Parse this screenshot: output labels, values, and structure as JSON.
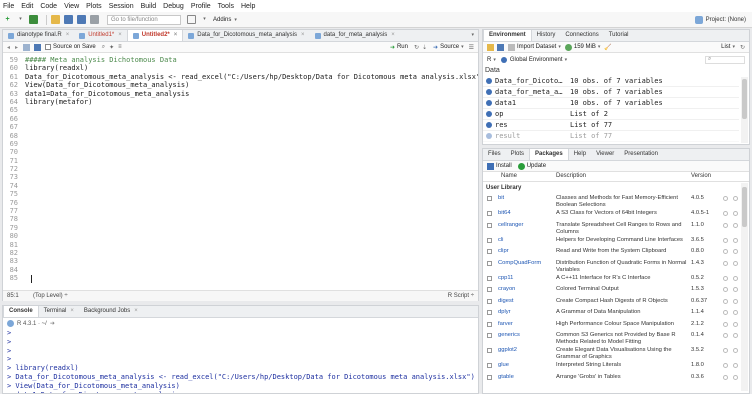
{
  "menu": [
    "File",
    "Edit",
    "Code",
    "View",
    "Plots",
    "Session",
    "Build",
    "Debug",
    "Profile",
    "Tools",
    "Help"
  ],
  "toolbar": {
    "goto_placeholder": "Go to file/function",
    "addins_label": "Addins",
    "project_label": "Project: (None)"
  },
  "editor": {
    "tabs": [
      {
        "label": "dianotype final.R",
        "active": false,
        "modified": false
      },
      {
        "label": "Untitled1*",
        "active": false,
        "modified": true
      },
      {
        "label": "Untitled2*",
        "active": true,
        "modified": true
      },
      {
        "label": "Data_for_Dicotomous_meta_analysis",
        "active": false,
        "modified": false
      },
      {
        "label": "data_for_meta_analysis",
        "active": false,
        "modified": false
      }
    ],
    "source_on_save": "Source on Save",
    "run_label": "Run",
    "source_label": "Source",
    "lines": [
      {
        "num": "59",
        "text": "##### Meta analysis Dichotomous Data",
        "kind": "comment"
      },
      {
        "num": "60",
        "text": "library(readxl)",
        "kind": "code"
      },
      {
        "num": "61",
        "text": "Data_for_Dicotomous_meta_analysis <- read_excel(\"C:/Users/hp/Desktop/Data for Dicotomous meta analysis.xlsx\")",
        "kind": "code"
      },
      {
        "num": "62",
        "text": "View(Data_for_Dicotomous_meta_analysis)",
        "kind": "code"
      },
      {
        "num": "63",
        "text": "data1=Data_for_Dicotomous_meta_analysis",
        "kind": "code"
      },
      {
        "num": "64",
        "text": "library(metafor)",
        "kind": "code"
      },
      {
        "num": "65",
        "text": "",
        "kind": "code"
      },
      {
        "num": "66",
        "text": "",
        "kind": "code"
      },
      {
        "num": "67",
        "text": "",
        "kind": "code"
      },
      {
        "num": "68",
        "text": "",
        "kind": "code"
      },
      {
        "num": "69",
        "text": "",
        "kind": "code"
      },
      {
        "num": "70",
        "text": "",
        "kind": "code"
      },
      {
        "num": "71",
        "text": "",
        "kind": "code"
      },
      {
        "num": "72",
        "text": "",
        "kind": "code"
      },
      {
        "num": "73",
        "text": "",
        "kind": "code"
      },
      {
        "num": "74",
        "text": "",
        "kind": "code"
      },
      {
        "num": "75",
        "text": "",
        "kind": "code"
      },
      {
        "num": "76",
        "text": "",
        "kind": "code"
      },
      {
        "num": "77",
        "text": "",
        "kind": "code"
      },
      {
        "num": "78",
        "text": "",
        "kind": "code"
      },
      {
        "num": "79",
        "text": "",
        "kind": "code"
      },
      {
        "num": "80",
        "text": "",
        "kind": "code"
      },
      {
        "num": "81",
        "text": "",
        "kind": "code"
      },
      {
        "num": "82",
        "text": "",
        "kind": "code"
      },
      {
        "num": "83",
        "text": "",
        "kind": "code"
      },
      {
        "num": "84",
        "text": "",
        "kind": "code"
      },
      {
        "num": "85",
        "text": "",
        "kind": "code"
      }
    ],
    "status_pos": "85:1",
    "status_level": "(Top Level) ÷",
    "status_type": "R Script ÷"
  },
  "console": {
    "tabs": [
      "Console",
      "Terminal",
      "Background Jobs"
    ],
    "r_version": "R 4.3.1 · ~/",
    "lines": [
      ">",
      ">",
      ">",
      ">",
      "> library(readxl)",
      "> Data_for_Dicotomous_meta_analysis <- read_excel(\"C:/Users/hp/Desktop/Data for Dicotomous meta analysis.xlsx\")",
      "> View(Data_for_Dicotomous_meta_analysis)",
      "> data1=Data_for_Dicotomous_meta_analysis",
      "> library(metafor)"
    ]
  },
  "environment": {
    "tabs": [
      "Environment",
      "History",
      "Connections",
      "Tutorial"
    ],
    "import_label": "Import Dataset",
    "memory": "159 MiB",
    "view_mode": "List",
    "lang": "R",
    "scope": "Global Environment",
    "section": "Data",
    "rows": [
      {
        "name": "Data_for_Dicoto…",
        "value": "10 obs. of 7 variables"
      },
      {
        "name": "data_for_meta_a…",
        "value": "10 obs. of 7 variables"
      },
      {
        "name": "data1",
        "value": "10 obs. of 7 variables"
      },
      {
        "name": "op",
        "value": "List of  2"
      },
      {
        "name": "res",
        "value": "List of  77"
      },
      {
        "name": "result",
        "value": "List of  77"
      }
    ]
  },
  "files_pane": {
    "tabs": [
      "Files",
      "Plots",
      "Packages",
      "Help",
      "Viewer",
      "Presentation"
    ],
    "install_label": "Install",
    "update_label": "Update",
    "col_name": "Name",
    "col_desc": "Description",
    "col_ver": "Version",
    "section": "User Library",
    "packages": [
      {
        "name": "bit",
        "desc": "Classes and Methods for Fast Memory-Efficient Boolean Selections",
        "ver": "4.0.5",
        "lines": 2
      },
      {
        "name": "bit64",
        "desc": "A S3 Class for Vectors of 64bit Integers",
        "ver": "4.0.5-1",
        "lines": 1
      },
      {
        "name": "cellranger",
        "desc": "Translate Spreadsheet Cell Ranges to Rows and Columns",
        "ver": "1.1.0",
        "lines": 2
      },
      {
        "name": "cli",
        "desc": "Helpers for Developing Command Line Interfaces",
        "ver": "3.6.5",
        "lines": 1
      },
      {
        "name": "clipr",
        "desc": "Read and Write from the System Clipboard",
        "ver": "0.8.0",
        "lines": 1
      },
      {
        "name": "CompQuadForm",
        "desc": "Distribution Function of Quadratic Forms in Normal Variables",
        "ver": "1.4.3",
        "lines": 2
      },
      {
        "name": "cpp11",
        "desc": "A C++11 Interface for R's C Interface",
        "ver": "0.5.2",
        "lines": 1
      },
      {
        "name": "crayon",
        "desc": "Colored Terminal Output",
        "ver": "1.5.3",
        "lines": 1
      },
      {
        "name": "digest",
        "desc": "Create Compact Hash Digests of R Objects",
        "ver": "0.6.37",
        "lines": 1
      },
      {
        "name": "dplyr",
        "desc": "A Grammar of Data Manipulation",
        "ver": "1.1.4",
        "lines": 1
      },
      {
        "name": "farver",
        "desc": "High Performance Colour Space Manipulation",
        "ver": "2.1.2",
        "lines": 1
      },
      {
        "name": "generics",
        "desc": "Common S3 Generics not Provided by Base R Methods Related to Model Fitting",
        "ver": "0.1.4",
        "lines": 2
      },
      {
        "name": "ggplot2",
        "desc": "Create Elegant Data Visualisations Using the Grammar of Graphics",
        "ver": "3.5.2",
        "lines": 2
      },
      {
        "name": "glue",
        "desc": "Interpreted String Literals",
        "ver": "1.8.0",
        "lines": 1
      },
      {
        "name": "gtable",
        "desc": "Arrange 'Grobs' in Tables",
        "ver": "0.3.6",
        "lines": 1
      }
    ]
  }
}
